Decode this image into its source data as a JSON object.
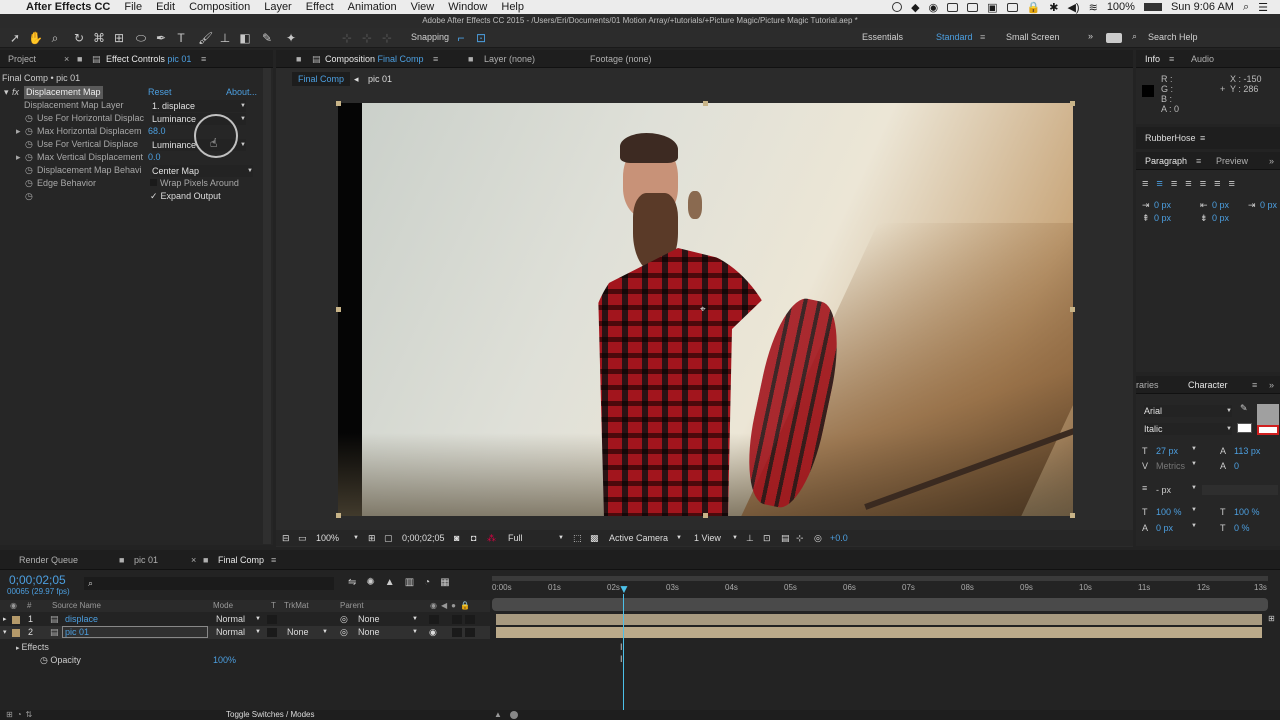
{
  "menubar": {
    "apple": "",
    "app": "After Effects CC",
    "items": [
      "File",
      "Edit",
      "Composition",
      "Layer",
      "Effect",
      "Animation",
      "View",
      "Window",
      "Help"
    ],
    "battery": "100%",
    "clock": "Sun 9:06 AM"
  },
  "window_title": "Adobe After Effects CC 2015 - /Users/Eri/Documents/01 Motion Array/+tutorials/+Picture Magic/Picture Magic Tutorial.aep *",
  "toolbar": {
    "snapping": "Snapping",
    "workspaces": [
      "Essentials",
      "Standard",
      "Small Screen"
    ],
    "active_workspace": "Standard",
    "search_help": "Search Help"
  },
  "effect_controls": {
    "tabs": {
      "project": "Project",
      "effect_controls": "Effect Controls",
      "effect_controls_layer": "pic 01"
    },
    "breadcrumb": "Final Comp • pic 01",
    "effect_name": "Displacement Map",
    "reset": "Reset",
    "about": "About...",
    "rows": [
      {
        "label": "Displacement Map Layer",
        "value": "1. displace"
      },
      {
        "label": "Use For Horizontal Displac",
        "value": "Luminance"
      },
      {
        "label": "Max Horizontal Displacem",
        "value": "68.0"
      },
      {
        "label": "Use For Vertical Displace",
        "value": "Luminance"
      },
      {
        "label": "Max Vertical Displacement",
        "value": "0.0"
      },
      {
        "label": "Displacement Map Behavi",
        "value": "Center Map"
      },
      {
        "label": "Edge Behavior",
        "value": "Wrap Pixels Around"
      },
      {
        "label": "",
        "value": "Expand Output"
      }
    ]
  },
  "composition": {
    "tab_label": "Composition",
    "tab_comp": "Final Comp",
    "layer_tab": "Layer (none)",
    "footage_tab": "Footage (none)",
    "crumb_active": "Final Comp",
    "crumb_next": "pic 01",
    "viewer_bar": {
      "zoom": "100%",
      "timecode": "0;00;02;05",
      "resolution": "Full",
      "camera": "Active Camera",
      "views": "1 View",
      "exposure": "+0.0"
    }
  },
  "info_panel": {
    "tabs": [
      "Info",
      "Audio"
    ],
    "r": "R :",
    "g": "G :",
    "b": "B :",
    "a": "A : 0",
    "x": "X : -150",
    "y": "Y : 286"
  },
  "rubberhose": "RubberHose",
  "paragraph": {
    "tabs": [
      "Paragraph",
      "Preview"
    ],
    "values": [
      "0 px",
      "0 px",
      "0 px",
      "0 px",
      "0 px"
    ]
  },
  "character": {
    "tabs": [
      "raries",
      "Character"
    ],
    "font": "Arial",
    "style": "Italic",
    "size": "27 px",
    "leading": "113 px",
    "kerning": "Metrics",
    "tracking": "0",
    "stroke": "- px",
    "vscale": "100 %",
    "hscale": "100 %",
    "baseline": "0 px",
    "tsume": "0 %"
  },
  "timeline": {
    "tabs": [
      "Render Queue",
      "pic 01",
      "Final Comp"
    ],
    "current_time": "0;00;02;05",
    "frame_info": "00065 (29.97 fps)",
    "columns": {
      "num": "#",
      "source": "Source Name",
      "mode": "Mode",
      "t": "T",
      "trkmat": "TrkMat",
      "parent": "Parent"
    },
    "layers": [
      {
        "num": "1",
        "name": "displace",
        "mode": "Normal",
        "trkmat": "",
        "parent": "None"
      },
      {
        "num": "2",
        "name": "pic 01",
        "mode": "Normal",
        "trkmat": "None",
        "parent": "None"
      }
    ],
    "effects_label": "Effects",
    "opacity_label": "Opacity",
    "opacity_value": "100%",
    "ruler": [
      "0:00s",
      "01s",
      "02s",
      "03s",
      "04s",
      "05s",
      "06s",
      "07s",
      "08s",
      "09s",
      "10s",
      "11s",
      "12s",
      "13s"
    ],
    "toggle": "Toggle Switches / Modes"
  }
}
